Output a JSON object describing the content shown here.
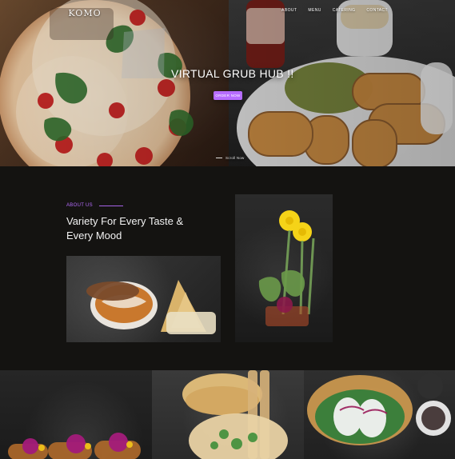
{
  "brand": {
    "logo_text": "KOMO",
    "tagline": ""
  },
  "nav": {
    "items": [
      {
        "label": "ABOUT"
      },
      {
        "label": "MENU"
      },
      {
        "label": "CATERING"
      },
      {
        "label": "CONTACT"
      }
    ]
  },
  "hero": {
    "title": "VIRTUAL GRUB HUB !!",
    "button_label": "ORDER NOW",
    "scroll_label": "Scroll Now"
  },
  "about": {
    "kicker": "ABOUT US",
    "heading_line1": "Variety For Every Taste &",
    "heading_line2": "Every Mood"
  },
  "icons": {
    "pizza": "pizza-icon",
    "croquettes": "croquettes-icon",
    "samosa": "samosa-icon",
    "flowers": "flowers-icon",
    "dumplings": "dumplings-icon"
  },
  "colors": {
    "accent": "#b66cff",
    "background": "#141311",
    "text": "#f2f2f2"
  }
}
